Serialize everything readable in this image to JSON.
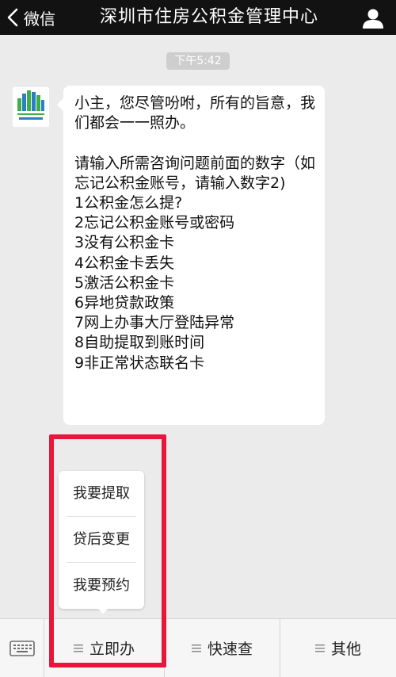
{
  "nav": {
    "back_label": "微信",
    "title": "深圳市住房公积金管理中心"
  },
  "chat": {
    "timestamp": "下午5:42",
    "message": "小主，您尽管吩咐，所有的旨意，我们都会一一照办。\n\n请输入所需咨询问题前面的数字（如忘记公积金账号，请输入数字2)\n1公积金怎么提?\n2忘记公积金账号或密码\n3没有公积金卡\n4公积金卡丢失\n5激活公积金卡\n6异地贷款政策\n7网上办事大厅登陆异常\n8自助提取到账时间\n9非正常状态联名卡"
  },
  "popup_menu": {
    "items": [
      "我要提取",
      "贷后变更",
      "我要预约"
    ]
  },
  "bottom_menu": {
    "tabs": [
      "立即办",
      "快速查",
      "其他"
    ]
  },
  "colors": {
    "navbar": "#121212",
    "background": "#ebebeb",
    "highlight": "#e8163a",
    "avatar_green": "#3fae49",
    "avatar_blue": "#2c7fc4"
  },
  "icons": [
    "back-chevron-icon",
    "profile-icon",
    "keyboard-icon",
    "menu-lines-icon"
  ]
}
